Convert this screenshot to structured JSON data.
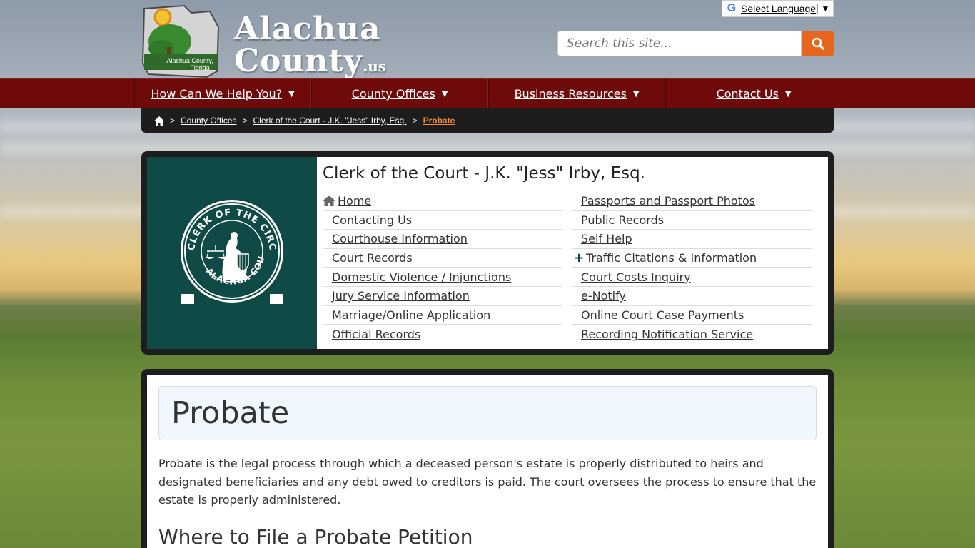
{
  "header": {
    "logo_caption": "Alachua County, Florida",
    "brand_line1": "Alachua",
    "brand_line2": "County",
    "brand_suffix": ".us"
  },
  "translate": {
    "label": "Select Language",
    "arrow": "▼"
  },
  "search": {
    "placeholder": "Search this site...",
    "icon": "search-icon"
  },
  "nav": {
    "items": [
      {
        "label": "How Can We Help You?",
        "caret": "▼"
      },
      {
        "label": "County Offices",
        "caret": "▼"
      },
      {
        "label": "Business Resources",
        "caret": "▼"
      },
      {
        "label": "Contact Us",
        "caret": "▼"
      }
    ]
  },
  "breadcrumb": {
    "home_icon": "home-icon",
    "sep": ">",
    "items": [
      "County Offices",
      "Clerk of the Court - J.K. \"Jess\" Irby, Esq."
    ],
    "current": "Probate"
  },
  "clerk_panel": {
    "seal_text": "CLERK OF THE CIRCUIT COURT ALACHUA COUNTY",
    "title": "Clerk of the Court - J.K. \"Jess\" Irby, Esq.",
    "left_menu": [
      "Home",
      "Contacting Us",
      "Courthouse Information",
      "Court Records",
      "Domestic Violence / Injunctions",
      "Jury Service Information",
      "Marriage/Online Application",
      "Official Records"
    ],
    "right_menu": [
      "Passports and Passport Photos",
      "Public Records",
      "Self Help",
      "Traffic Citations & Information",
      "Court Costs Inquiry",
      "e-Notify",
      "Online Court Case Payments",
      "Recording Notification Service"
    ],
    "plus_symbol": "+"
  },
  "content": {
    "title": "Probate",
    "intro": "Probate is the legal process through which a deceased person's estate is properly distributed to heirs and designated beneficiaries and any debt owed to creditors is paid. The court oversees the process to ensure that the estate is properly administered.",
    "heading2": "Where to File a Probate Petition"
  },
  "colors": {
    "nav_bg": "#6e0a0a",
    "accent_orange": "#e5661c",
    "seal_bg": "#0f4a47",
    "panel_frame": "#1d1d1d",
    "breadcrumb_current": "#f08a3c"
  }
}
